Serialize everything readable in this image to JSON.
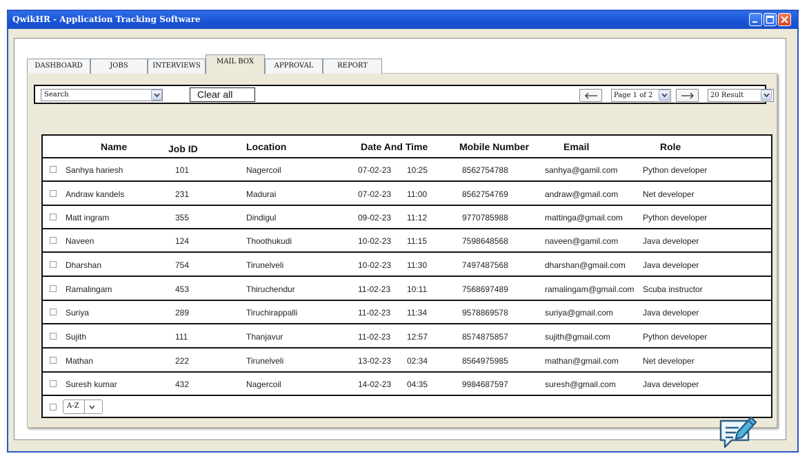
{
  "window": {
    "title": "QwikHR - Application Tracking Software",
    "controls": [
      "minimize-icon",
      "maximize-icon",
      "close-icon"
    ]
  },
  "tabs": [
    {
      "label": "DASHBOARD",
      "active": false
    },
    {
      "label": "JOBS",
      "active": false
    },
    {
      "label": "INTERVIEWS",
      "active": false
    },
    {
      "label": "MAIL BOX",
      "active": true
    },
    {
      "label": "APPROVAL",
      "active": false
    },
    {
      "label": "REPORT",
      "active": false
    }
  ],
  "filters": {
    "search_value": "Search",
    "clear_all_label": "Clear all",
    "page_value": "Page 1 of 2",
    "results_value": "20 Result"
  },
  "table": {
    "columns": [
      "Name",
      "Job ID",
      "Location",
      "Date And Time",
      "Mobile Number",
      "Email",
      "Role"
    ],
    "rows": [
      {
        "name": "Sanhya hariesh",
        "job_id": "101",
        "location": "Nagercoil",
        "date": "07-02-23",
        "time": "10:25",
        "mobile": "8562754788",
        "email": "sanhya@gamil.com",
        "role": "Python developer"
      },
      {
        "name": "Andraw kandels",
        "job_id": "231",
        "location": "Madurai",
        "date": "07-02-23",
        "time": "11:00",
        "mobile": "8562754769",
        "email": "andraw@gmail.com",
        "role": "Net developer"
      },
      {
        "name": "Matt ingram",
        "job_id": "355",
        "location": "Dindigul",
        "date": "09-02-23",
        "time": "11:12",
        "mobile": "9770785988",
        "email": "mattinga@gmail.com",
        "role": "Python developer"
      },
      {
        "name": "Naveen",
        "job_id": "124",
        "location": "Thoothukudi",
        "date": "10-02-23",
        "time": "11:15",
        "mobile": "7598648568",
        "email": "naveen@gamil.com",
        "role": "Java developer"
      },
      {
        "name": "Dharshan",
        "job_id": "754",
        "location": "Tirunelveli",
        "date": "10-02-23",
        "time": "11:30",
        "mobile": "7497487568",
        "email": "dharshan@gmail.com",
        "role": "Java developer"
      },
      {
        "name": "Ramalingam",
        "job_id": "453",
        "location": "Thiruchendur",
        "date": "11-02-23",
        "time": "10:11",
        "mobile": "7568697489",
        "email": "ramalingam@gmail.com",
        "role": "Scuba instructor"
      },
      {
        "name": "Suriya",
        "job_id": "289",
        "location": "Tiruchirappalli",
        "date": "11-02-23",
        "time": "11:34",
        "mobile": "9578869578",
        "email": "suriya@gmail.com",
        "role": "Java developer"
      },
      {
        "name": "Sujith",
        "job_id": "111",
        "location": "Thanjavur",
        "date": "11-02-23",
        "time": "12:57",
        "mobile": "8574875857",
        "email": "sujith@gmail.com",
        "role": "Python developer"
      },
      {
        "name": "Mathan",
        "job_id": "222",
        "location": "Tirunelveli",
        "date": "13-02-23",
        "time": "02:34",
        "mobile": "8564975985",
        "email": "mathan@gmail.com",
        "role": "Net developer"
      },
      {
        "name": "Suresh kumar",
        "job_id": "432",
        "location": "Nagercoil",
        "date": "14-02-23",
        "time": "04:35",
        "mobile": "9984687597",
        "email": "suresh@gmail.com",
        "role": "Java developer"
      }
    ]
  },
  "sort": {
    "label": "A-Z"
  },
  "colors": {
    "title_bar": "#1852d4",
    "window_border": "#2a56c6",
    "panel_bg": "#ece9d8",
    "close_button": "#d7401c"
  },
  "icons": {
    "edit": "edit-message-icon",
    "prev": "arrow-left-icon",
    "next": "arrow-right-icon"
  }
}
